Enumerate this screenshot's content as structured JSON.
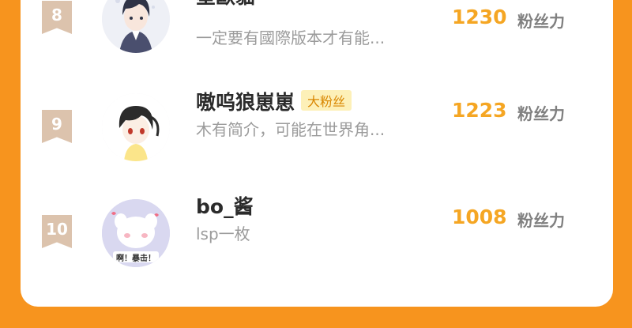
{
  "leaderboard": {
    "unit_label": "粉丝力",
    "rows": [
      {
        "rank": "8",
        "name": "星歐貓",
        "badge": "",
        "bio": "一定要有國際版本才有能...",
        "score": "1230"
      },
      {
        "rank": "9",
        "name": "嗷呜狼崽崽",
        "badge": "大粉丝",
        "bio": "木有简介，可能在世界角...",
        "score": "1223"
      },
      {
        "rank": "10",
        "name": "bo_酱",
        "badge": "",
        "bio": "lsp一枚",
        "score": "1008",
        "avatar_caption": "啊！暴击！"
      }
    ]
  },
  "colors": {
    "background": "#f7941e",
    "score": "#f5a623",
    "badge_bg": "#fdf0b8",
    "rank_ribbon": "#dcc3ad"
  }
}
